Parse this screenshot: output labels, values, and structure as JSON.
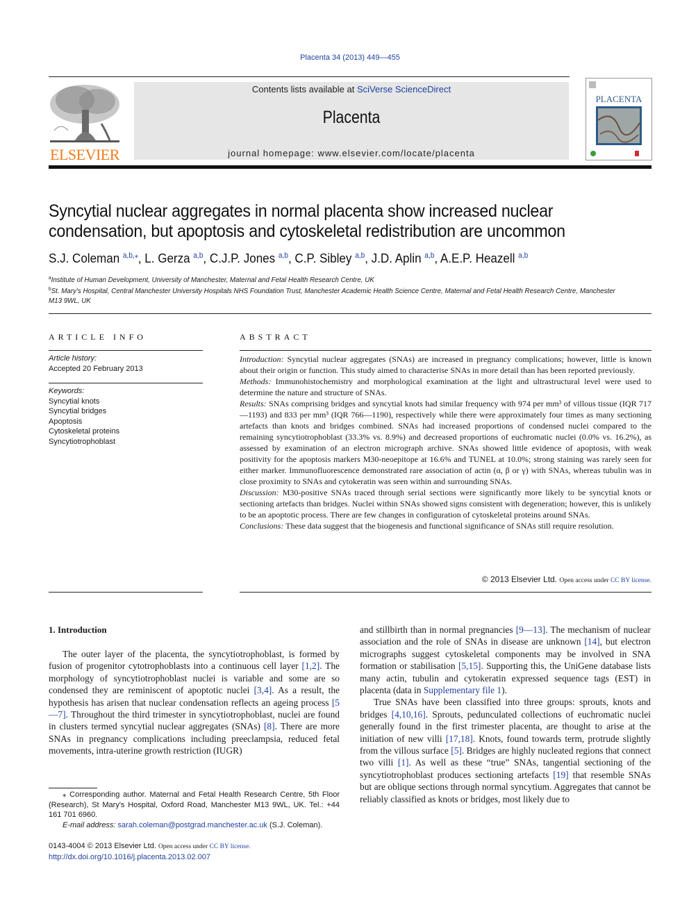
{
  "header": {
    "citation": "Placenta 34 (2013) 449—455",
    "contents_prefix": "Contents lists available at ",
    "contents_link": "SciVerse ScienceDirect",
    "journal_name": "Placenta",
    "homepage_prefix": "journal homepage: ",
    "homepage_url": "www.elsevier.com/locate/placenta",
    "publisher_logo_text": "ELSEVIER",
    "cover_title": "PLACENTA",
    "colors": {
      "publisher_orange": "#f07a1a",
      "link_blue": "#2140a0",
      "banner_gray": "#e6e6e6",
      "cover_blue": "#2d5a8a"
    }
  },
  "article": {
    "title": "Syncytial nuclear aggregates in normal placenta show increased nuclear condensation, but apoptosis and cytoskeletal redistribution are uncommon",
    "authors": [
      {
        "name": "S.J. Coleman",
        "aff": "a,b,⁎",
        "sep": ", "
      },
      {
        "name": "L. Gerza",
        "aff": "a,b",
        "sep": ", "
      },
      {
        "name": "C.J.P. Jones",
        "aff": "a,b",
        "sep": ", "
      },
      {
        "name": "C.P. Sibley",
        "aff": "a,b",
        "sep": ", "
      },
      {
        "name": "J.D. Aplin",
        "aff": "a,b",
        "sep": ", "
      },
      {
        "name": "A.E.P. Heazell",
        "aff": "a,b",
        "sep": ""
      }
    ],
    "affiliations": [
      {
        "mark": "a",
        "text": "Institute of Human Development, University of Manchester, Maternal and Fetal Health Research Centre, UK"
      },
      {
        "mark": "b",
        "text": "St. Mary's Hospital, Central Manchester University Hospitals NHS Foundation Trust, Manchester Academic Health Science Centre, Maternal and Fetal Health Research Centre, Manchester M13 9WL, UK"
      }
    ]
  },
  "article_info": {
    "heading": "ARTICLE INFO",
    "history_label": "Article history:",
    "accepted": "Accepted 20 February 2013",
    "keywords_label": "Keywords:",
    "keywords": [
      "Syncytial knots",
      "Syncytial bridges",
      "Apoptosis",
      "Cytoskeletal proteins",
      "Syncytiotrophoblast"
    ]
  },
  "abstract": {
    "heading": "ABSTRACT",
    "sections": [
      {
        "label": "Introduction:",
        "text": " Syncytial nuclear aggregates (SNAs) are increased in pregnancy complications; however, little is known about their origin or function. This study aimed to characterise SNAs in more detail than has been reported previously."
      },
      {
        "label": "Methods:",
        "text": " Immunohistochemistry and morphological examination at the light and ultrastructural level were used to determine the nature and structure of SNAs."
      },
      {
        "label": "Results:",
        "text": " SNAs comprising bridges and syncytial knots had similar frequency with 974 per mm³ of villous tissue (IQR 717—1193) and 833 per mm³ (IQR 766—1190), respectively while there were approximately four times as many sectioning artefacts than knots and bridges combined. SNAs had increased proportions of condensed nuclei compared to the remaining syncytiotrophoblast (33.3% vs. 8.9%) and decreased proportions of euchromatic nuclei (0.0% vs. 16.2%), as assessed by examination of an electron micrograph archive. SNAs showed little evidence of apoptosis, with weak positivity for the apoptosis markers M30-neoepitope at 16.6% and TUNEL at 10.0%; strong staining was rarely seen for either marker. Immunofluorescence demonstrated rare association of actin (α, β or γ) with SNAs, whereas tubulin was in close proximity to SNAs and cytokeratin was seen within and surrounding SNAs."
      },
      {
        "label": "Discussion:",
        "text": " M30-positive SNAs traced through serial sections were significantly more likely to be syncytial knots or sectioning artefacts than bridges. Nuclei within SNAs showed signs consistent with degeneration; however, this is unlikely to be an apoptotic process. There are few changes in configuration of cytoskeletal proteins around SNAs."
      },
      {
        "label": "Conclusions:",
        "text": " These data suggest that the biogenesis and functional significance of SNAs still require resolution."
      }
    ],
    "copyright": "© 2013 Elsevier Ltd. ",
    "open_access": "Open access under ",
    "license_link": "CC BY license."
  },
  "body": {
    "intro_heading": "1.  Introduction",
    "left_paragraph": [
      {
        "t": "The outer layer of the placenta, the syncytiotrophoblast, is formed by fusion of progenitor cytotrophoblasts into a continuous cell layer "
      },
      {
        "ref": "[1,2]"
      },
      {
        "t": ". The morphology of syncytiotrophoblast nuclei is variable and some are so condensed they are reminiscent of apoptotic nuclei "
      },
      {
        "ref": "[3,4]"
      },
      {
        "t": ". As a result, the hypothesis has arisen that nuclear condensation reflects an ageing process "
      },
      {
        "ref": "[5—7]"
      },
      {
        "t": ". Throughout the third trimester in syncytiotrophoblast, nuclei are found in clusters termed syncytial nuclear aggregates (SNAs) "
      },
      {
        "ref": "[8]"
      },
      {
        "t": ". There are more SNAs in pregnancy complications including preeclampsia, reduced fetal movements, intra-uterine growth restriction (IUGR)"
      }
    ],
    "right_paragraph_1": [
      {
        "t": "and stillbirth than in normal pregnancies "
      },
      {
        "ref": "[9—13]"
      },
      {
        "t": ". The mechanism of nuclear association and the role of SNAs in disease are unknown "
      },
      {
        "ref": "[14]"
      },
      {
        "t": ", but electron micrographs suggest cytoskeletal components may be involved in SNA formation or stabilisation "
      },
      {
        "ref": "[5,15]"
      },
      {
        "t": ". Supporting this, the UniGene database lists many actin, tubulin and cytokeratin expressed sequence tags (EST) in placenta (data in "
      },
      {
        "ref": "Supplementary file 1"
      },
      {
        "t": ")."
      }
    ],
    "right_paragraph_2": [
      {
        "t": "True SNAs have been classified into three groups: sprouts, knots and bridges "
      },
      {
        "ref": "[4,10,16]"
      },
      {
        "t": ". Sprouts, pedunculated collections of euchromatic nuclei generally found in the first trimester placenta, are thought to arise at the initiation of new villi "
      },
      {
        "ref": "[17,18]"
      },
      {
        "t": ". Knots, found towards term, protrude slightly from the villous surface "
      },
      {
        "ref": "[5]"
      },
      {
        "t": ". Bridges are highly nucleated regions that connect two villi "
      },
      {
        "ref": "[1]"
      },
      {
        "t": ". As well as these “true” SNAs, tangential sectioning of the syncytiotrophoblast produces sectioning artefacts "
      },
      {
        "ref": "[19]"
      },
      {
        "t": " that resemble SNAs but are oblique sections through normal syncytium. Aggregates that cannot be reliably classified as knots or bridges, most likely due to"
      }
    ]
  },
  "footnote": {
    "corresponding": "⁎ Corresponding author. Maternal and Fetal Health Research Centre, 5th Floor (Research), St Mary's Hospital, Oxford Road, Manchester M13 9WL, UK. Tel.: +44 161 701 6960.",
    "email_label": "E-mail address: ",
    "email": "sarah.coleman@postgrad.manchester.ac.uk",
    "email_suffix": " (S.J. Coleman)."
  },
  "footer": {
    "issn": "0143-4004 © 2013 Elsevier Ltd. ",
    "open_access": "Open access under ",
    "license_link": "CC BY license.",
    "doi": "http://dx.doi.org/10.1016/j.placenta.2013.02.007"
  }
}
